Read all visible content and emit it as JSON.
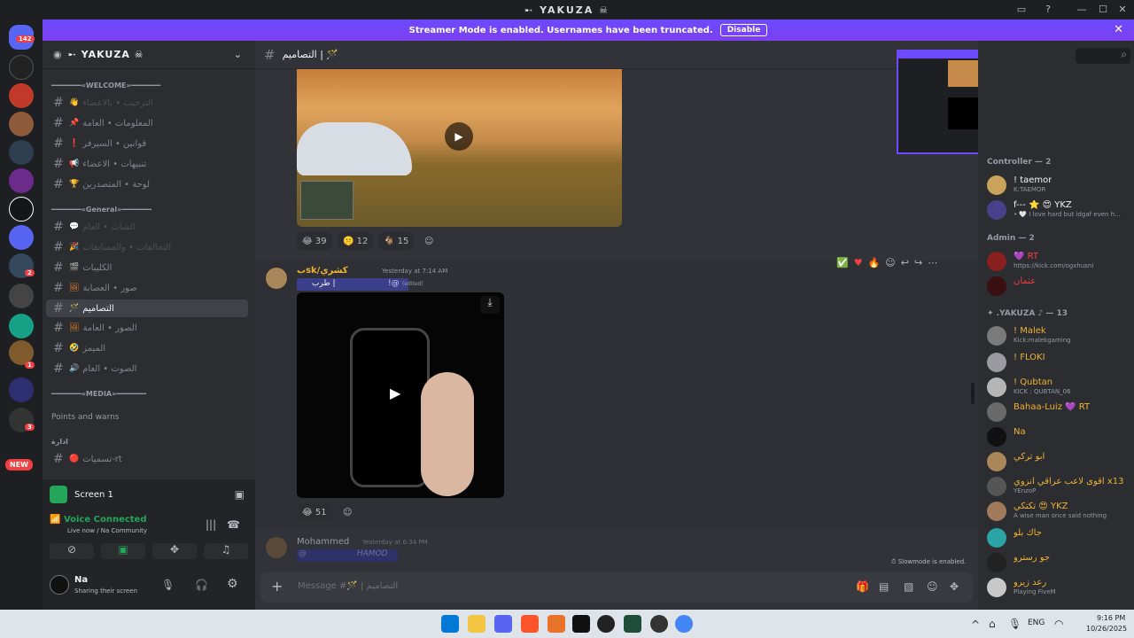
{
  "window": {
    "title": "➸ YAKUZA ☠",
    "min": "—",
    "max": "☐",
    "close": "✕"
  },
  "banner": {
    "text": "Streamer Mode is enabled. Usernames have been truncated.",
    "disable": "Disable"
  },
  "rail": {
    "badge_top": "142",
    "badge_a": "2",
    "badge_b": "1",
    "badge_c": "3",
    "new": "NEW"
  },
  "server": {
    "name": "➸ YAKUZA ☠"
  },
  "categories": {
    "welcome": "━━━━━━━«WELCOME»━━━━━━━",
    "general": "━━━━━━━«General»━━━━━━━",
    "media": "━━━━━━━«MEDIA»━━━━━━━",
    "points": "Points and warns",
    "idara": "ادارة"
  },
  "channels": [
    {
      "name": "الترحيب • بالاعضاء",
      "emoji": "👋",
      "dim": true
    },
    {
      "name": "المعلومات • العامة",
      "emoji": "📌",
      "dim": false
    },
    {
      "name": "قوانين • السيرفر",
      "emoji": "❗",
      "dim": false
    },
    {
      "name": "تنبيهات • الاعضاء",
      "emoji": "📢",
      "dim": false
    },
    {
      "name": "لوحة • المتصدرين",
      "emoji": "🏆",
      "dim": false
    },
    {
      "name": "الشات • العام",
      "emoji": "💬",
      "dim": true
    },
    {
      "name": "التحالفات • والمسابقات",
      "emoji": "🎉",
      "dim": true
    },
    {
      "name": "الكليبات",
      "emoji": "🎬",
      "dim": false
    },
    {
      "name": "صور • العصابة",
      "emoji": "🖼",
      "dim": false
    },
    {
      "name": "التصاميم",
      "emoji": "🪄",
      "dim": false,
      "active": true
    },
    {
      "name": "الصور • العامة",
      "emoji": "🖼",
      "dim": false
    },
    {
      "name": "الميمز",
      "emoji": "🤣",
      "dim": false
    },
    {
      "name": "الصوت • العام",
      "emoji": "🔊",
      "dim": false
    },
    {
      "name": "تسميات-rt",
      "emoji": "🔴",
      "dim": false
    }
  ],
  "screenshare": {
    "label": "Screen 1"
  },
  "voice": {
    "status": "Voice Connected",
    "detail": "Live now / Na Community"
  },
  "user": {
    "name": "Na",
    "status": "Sharing their screen"
  },
  "chat": {
    "channel": "التصاميم | 🪄",
    "reactions1": [
      {
        "e": "😂",
        "n": "39"
      },
      {
        "e": "🤫",
        "n": "12"
      },
      {
        "e": "🐐",
        "n": "15"
      }
    ],
    "msg1": {
      "author": "بsk/كشري",
      "time": "Yesterday at 7:14 AM",
      "text": "طرب |",
      "mention": "!@",
      "edited": "(edited)"
    },
    "reactions2": [
      {
        "e": "😂",
        "n": "51"
      }
    ],
    "msg2": {
      "author": "Mohammed",
      "time": "Yesterday at 6:34 PM",
      "mention": "@",
      "blur": "HAMOD"
    },
    "slowmode": "Slowmode is enabled.",
    "placeholder": "Message #🪄 | التصاميم"
  },
  "members": {
    "controller": "Controller — 2",
    "admin": "Admin — 2",
    "yakuza": "✦ .YAKUZA ♪ — 13",
    "list": [
      {
        "name": "! taemor",
        "status": "K:TAEMOR",
        "color": "#f2f3f5"
      },
      {
        "name": "f--- ⭐ 😍 YKZ",
        "status": "• 🤍 I love hard but idgaf even h...",
        "color": "#f2f3f5"
      },
      {
        "name": "💜 RT",
        "status": "https://kick.com/ogxhusni",
        "color": "#f23f43"
      },
      {
        "name": "عثمان",
        "status": "",
        "color": "#f23f43"
      },
      {
        "name": "! Malek",
        "status": "Kick:malekgaming",
        "color": "#f0b232"
      },
      {
        "name": "! FLOKI",
        "status": "",
        "color": "#f0b232"
      },
      {
        "name": "! Qubtan",
        "status": "KICK : QUBTAN_06",
        "color": "#f0b232"
      },
      {
        "name": "Bahaa-Luiz 💜 RT",
        "status": "",
        "color": "#f0b232"
      },
      {
        "name": "Na",
        "status": "",
        "color": "#f0b232"
      },
      {
        "name": "ابو تركي",
        "status": "",
        "color": "#f0b232"
      },
      {
        "name": "اقوى لاعب عراقي انزوي x13",
        "status": "YEnzoP",
        "color": "#f0b232"
      },
      {
        "name": "تكتكي 😍 YKZ",
        "status": "A wise man once said nothing",
        "color": "#f0b232"
      },
      {
        "name": "جاك بلو",
        "status": "",
        "color": "#f0b232"
      },
      {
        "name": "جو رسترو",
        "status": "",
        "color": "#f0b232"
      },
      {
        "name": "رعد زيرو",
        "status": "Playing FiveM",
        "color": "#f0b232"
      }
    ]
  },
  "taskbar": {
    "lang": "ENG",
    "time": "9:16 PM",
    "date": "10/26/2025"
  }
}
